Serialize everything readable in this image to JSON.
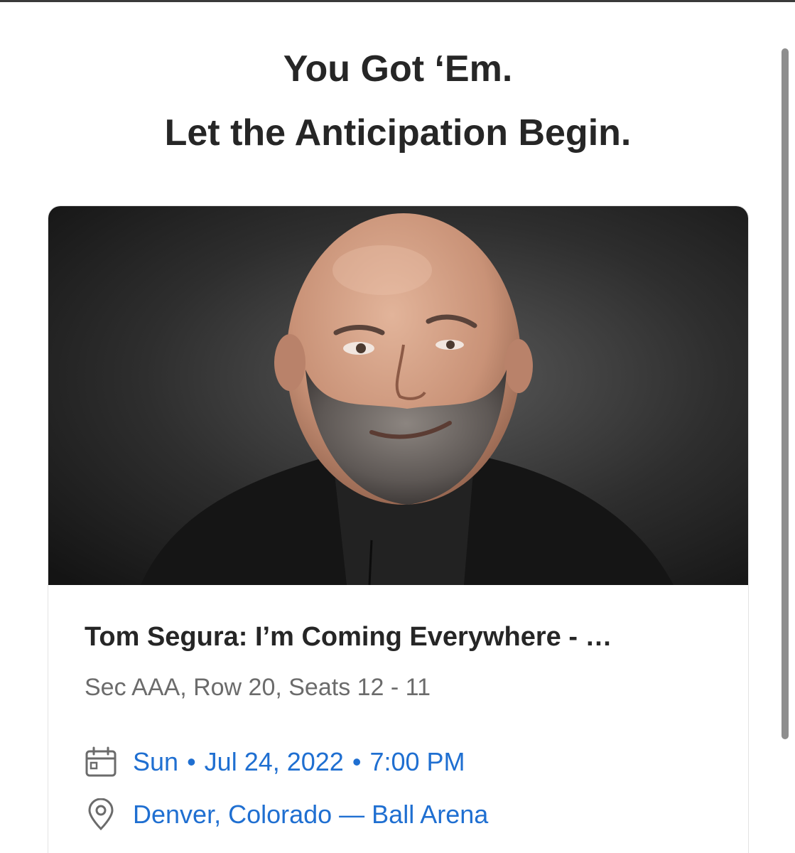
{
  "headline": {
    "line1": "You Got ‘Em.",
    "line2": "Let the Anticipation Begin."
  },
  "event": {
    "title": "Tom Segura: I’m Coming Everywhere - …",
    "seats": "Sec AAA, Row 20, Seats 12 - 11",
    "day": "Sun",
    "date": "Jul 24, 2022",
    "time": "7:00 PM",
    "separator": "•",
    "location": "Denver, Colorado — Ball Arena"
  },
  "icons": {
    "date": "calendar-icon",
    "location": "location-pin-icon"
  },
  "colors": {
    "accent": "#1f6fd1",
    "heading": "#262626",
    "subtext": "#6b6b6b"
  }
}
